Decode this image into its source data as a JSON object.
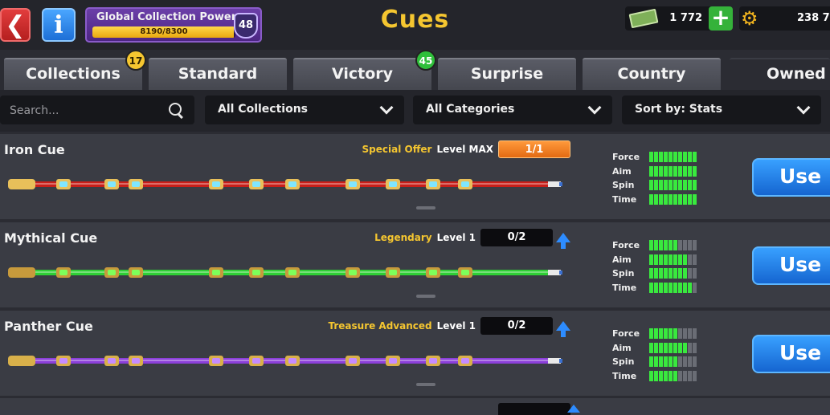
{
  "header": {
    "title": "Cues",
    "global_collection_power": {
      "label": "Global Collection Power",
      "value_text": "8190/8300",
      "progress": 0.987,
      "level": "48"
    },
    "cash": {
      "amount": "1 772",
      "add_label": "+"
    },
    "coins": {
      "amount": "238 7"
    }
  },
  "tabs": [
    {
      "label": "Collections",
      "badge": "17",
      "badge_color": "#f5c630"
    },
    {
      "label": "Standard"
    },
    {
      "label": "Victory",
      "badge": "45",
      "badge_color": "#2fbf3a"
    },
    {
      "label": "Surprise"
    },
    {
      "label": "Country"
    },
    {
      "label": "Owned",
      "active": true
    }
  ],
  "filters": {
    "search_placeholder": "Search...",
    "collection": "All Collections",
    "category": "All Categories",
    "sort": "Sort by: Stats"
  },
  "stat_labels": [
    "Force",
    "Aim",
    "Spin",
    "Time"
  ],
  "cues": [
    {
      "name": "Iron Cue",
      "rarity": "Special Offer",
      "level": "Level MAX",
      "progress": "1/1",
      "progress_style": "orange",
      "upgradable": false,
      "stats": [
        10,
        10,
        10,
        10
      ],
      "use_label": "Use",
      "colors": {
        "shaft": "#c81f1a",
        "accent": "#7fe6ff",
        "metal": "#e8c05a"
      }
    },
    {
      "name": "Mythical Cue",
      "rarity": "Legendary",
      "level": "Level 1",
      "progress": "0/2",
      "progress_style": "black",
      "upgradable": true,
      "stats": [
        6,
        8,
        8,
        9
      ],
      "use_label": "Use",
      "colors": {
        "shaft": "#2fcf35",
        "accent": "#7dff5a",
        "metal": "#c79a3c"
      }
    },
    {
      "name": "Panther Cue",
      "rarity": "Treasure Advanced",
      "level": "Level 1",
      "progress": "0/2",
      "progress_style": "black",
      "upgradable": true,
      "stats": [
        6,
        8,
        6,
        6
      ],
      "use_label": "Use",
      "colors": {
        "shaft": "#8b3fd9",
        "accent": "#c58cff",
        "metal": "#d8b04a"
      }
    }
  ]
}
